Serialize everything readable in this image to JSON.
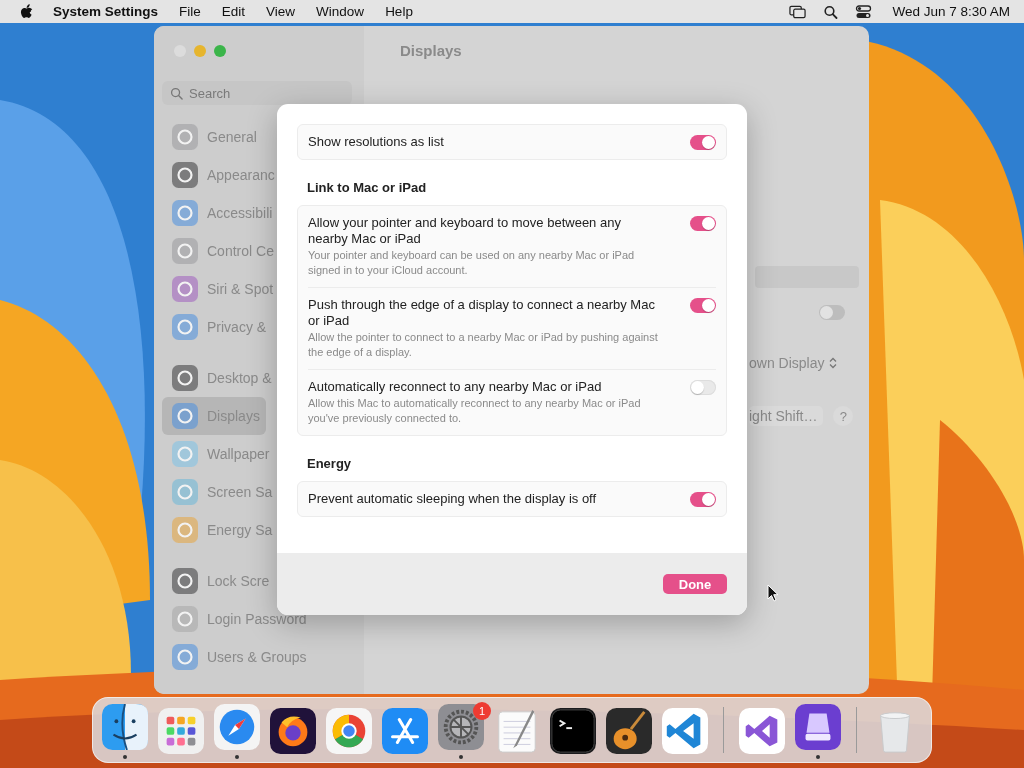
{
  "menu_bar": {
    "app_name": "System Settings",
    "menus": [
      "File",
      "Edit",
      "View",
      "Window",
      "Help"
    ],
    "clock": "Wed Jun 7  8:30 AM"
  },
  "window": {
    "title": "Displays",
    "search": {
      "placeholder": "Search"
    },
    "sidebar": {
      "groups": [
        [
          {
            "label": "General",
            "selected": false
          },
          {
            "label": "Appearanc",
            "selected": false
          },
          {
            "label": "Accessibili",
            "selected": false
          },
          {
            "label": "Control Ce",
            "selected": false
          },
          {
            "label": "Siri & Spot",
            "selected": false
          },
          {
            "label": "Privacy &",
            "selected": false
          }
        ],
        [
          {
            "label": "Desktop &",
            "selected": false
          },
          {
            "label": "Displays",
            "selected": true
          },
          {
            "label": "Wallpaper",
            "selected": false
          },
          {
            "label": "Screen Sa",
            "selected": false
          },
          {
            "label": "Energy Sa",
            "selected": false
          }
        ],
        [
          {
            "label": "Lock Scre",
            "selected": false
          },
          {
            "label": "Login Password",
            "selected": false
          },
          {
            "label": "Users & Groups",
            "selected": false
          }
        ]
      ]
    },
    "pane": {
      "toggle_on": false,
      "popup_value": "own Display",
      "button": "ight Shift…",
      "help": "?"
    }
  },
  "sheet": {
    "sections": [
      {
        "rows": [
          {
            "label": "Show resolutions as list",
            "on": true
          }
        ]
      },
      {
        "heading": "Link to Mac or iPad",
        "rows": [
          {
            "label": "Allow your pointer and keyboard to move between any nearby Mac or iPad",
            "description": "Your pointer and keyboard can be used on any nearby Mac or iPad signed in to your iCloud account.",
            "on": true
          },
          {
            "label": "Push through the edge of a display to connect a nearby Mac or iPad",
            "description": "Allow the pointer to connect to a nearby Mac or iPad by pushing against the edge of a display.",
            "on": true
          },
          {
            "label": "Automatically reconnect to any nearby Mac or iPad",
            "description": "Allow this Mac to automatically reconnect to any nearby Mac or iPad you've previously connected to.",
            "on": false
          }
        ]
      },
      {
        "heading": "Energy",
        "rows": [
          {
            "label": "Prevent automatic sleeping when the display is off",
            "on": true
          }
        ]
      }
    ],
    "done_button": "Done"
  },
  "dock": {
    "groups": [
      [
        {
          "kind": "face",
          "running": true
        },
        {
          "kind": "grid",
          "running": false
        },
        {
          "kind": "compass",
          "running": true
        },
        {
          "kind": "fox",
          "running": false
        },
        {
          "kind": "wheel",
          "running": false
        },
        {
          "kind": "store",
          "running": false
        },
        {
          "kind": "gear",
          "running": true,
          "badge": "1"
        },
        {
          "kind": "notepad",
          "running": false
        },
        {
          "kind": "terminal",
          "running": false
        },
        {
          "kind": "guitar",
          "running": false
        },
        {
          "kind": "code",
          "running": false
        }
      ],
      [
        {
          "kind": "studio",
          "running": false
        },
        {
          "kind": "device",
          "running": true
        }
      ],
      [
        {
          "kind": "trash",
          "running": false
        }
      ]
    ]
  }
}
